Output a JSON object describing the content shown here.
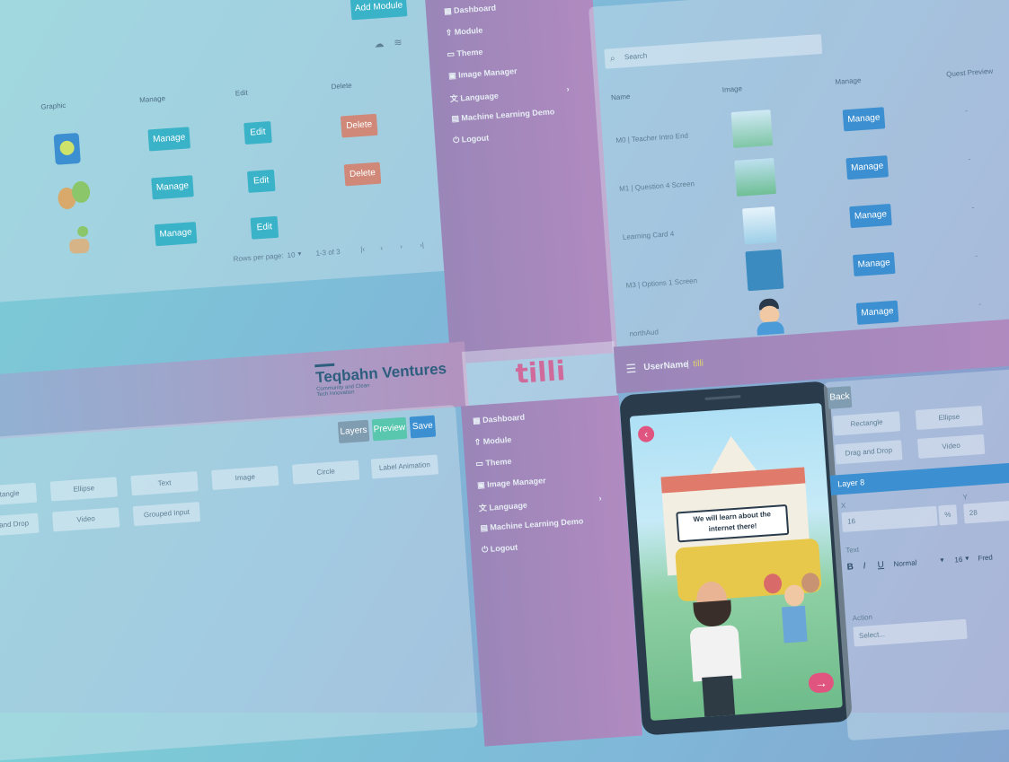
{
  "top_left": {
    "add_module": "Add Module",
    "headers": {
      "graphic": "Graphic",
      "manage": "Manage",
      "edit": "Edit",
      "delete": "Delete"
    },
    "rows": [
      {
        "manage": "Manage",
        "edit": "Edit",
        "delete": "Delete"
      },
      {
        "manage": "Manage",
        "edit": "Edit",
        "delete": "Delete"
      },
      {
        "manage": "Manage",
        "edit": "Edit"
      }
    ],
    "pagination": {
      "rows_label": "Rows per page:",
      "rows_value": "10",
      "range": "1-3 of 3"
    }
  },
  "top_sidebar": {
    "items": [
      "Dashboard",
      "Module",
      "Theme",
      "Image Manager",
      "Language",
      "Machine Learning Demo",
      "Logout"
    ]
  },
  "top_right": {
    "search_placeholder": "Search",
    "headers": {
      "name": "Name",
      "image": "Image",
      "manage": "Manage",
      "quest": "Quest Preview"
    },
    "rows": [
      {
        "name": "M0 | Teacher Intro End",
        "manage": "Manage",
        "quest": "-"
      },
      {
        "name": "M1 | Question 4 Screen",
        "manage": "Manage",
        "quest": "-"
      },
      {
        "name": "Learning Card 4",
        "manage": "Manage",
        "quest": "-"
      },
      {
        "name": "M3 | Options 1 Screen",
        "manage": "Manage",
        "quest": "-"
      },
      {
        "name": "northAud",
        "manage": "Manage",
        "quest": "-"
      }
    ]
  },
  "brand": {
    "company": "Teqbahn Ventures",
    "tagline": "Community and Clean Tech Innovation",
    "logo": "tilli"
  },
  "bottom_left": {
    "actions": {
      "layers": "Layers",
      "preview": "Preview",
      "save": "Save"
    },
    "shapes": [
      "Rectangle",
      "Ellipse",
      "Text",
      "Image",
      "Circle",
      "Label Animation",
      "Drag and Drop",
      "Video",
      "Grouped Input"
    ]
  },
  "bottom_sidebar": {
    "items": [
      "Dashboard",
      "Module",
      "Theme",
      "Image Manager",
      "Language",
      "Machine Learning Demo",
      "Logout"
    ]
  },
  "bottom_right": {
    "user": "UserName",
    "user_role": "tilli",
    "back": "Back",
    "shapes": [
      "Rectangle",
      "Ellipse",
      "Drag and Drop",
      "Video"
    ],
    "layer": "Layer 8",
    "x_label": "X",
    "x_value": "16",
    "unit": "%",
    "y_label": "Y",
    "y_value": "28",
    "text_label": "Text",
    "font_style": "Normal",
    "font_size": "16",
    "font_family": "Fred",
    "action_label": "Action",
    "action_placeholder": "Select...",
    "speech": "We will learn about the internet there!"
  },
  "colors": {
    "teal": "#3ab2c8",
    "green": "#59c6ae",
    "red": "#d08979",
    "blue": "#3c8fd0",
    "pink": "#b08ac0"
  }
}
